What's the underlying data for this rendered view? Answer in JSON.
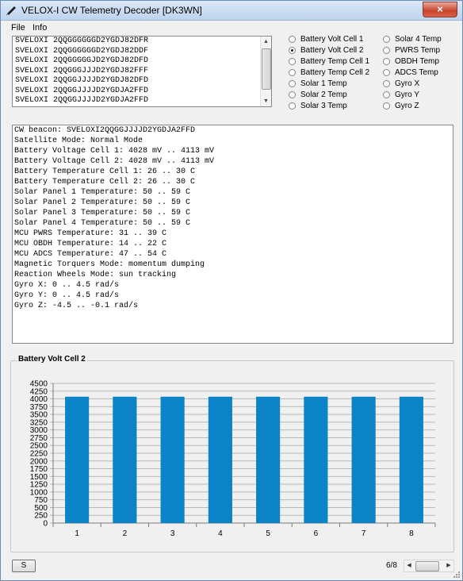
{
  "window": {
    "title": "VELOX-I CW Telemetry Decoder [DK3WN]",
    "close_symbol": "×"
  },
  "menu": {
    "items": [
      "File",
      "Info"
    ]
  },
  "beacon_list": [
    "SVELOXI 2QQGGGGGGD2YGDJ82DFR",
    "SVELOXI 2QQGGGGGGD2YGDJ82DDF",
    "SVELOXI 2QQGGGGGJD2YGDJ82DFD",
    "SVELOXI 2QQGGGJJJD2YGDJ82FFF",
    "SVELOXI 2QQGGJJJJD2YGDJ82DFD",
    "SVELOXI 2QQGGJJJJD2YGDJA2FFD",
    "SVELOXI 2QQGGJJJJD2YGDJA2FFD"
  ],
  "radio_col1": [
    {
      "label": "Battery Volt Cell 1",
      "checked": false
    },
    {
      "label": "Battery Volt Cell 2",
      "checked": true
    },
    {
      "label": "Battery Temp Cell 1",
      "checked": false
    },
    {
      "label": "Battery Temp Cell 2",
      "checked": false
    },
    {
      "label": "Solar 1 Temp",
      "checked": false
    },
    {
      "label": "Solar 2 Temp",
      "checked": false
    },
    {
      "label": "Solar 3 Temp",
      "checked": false
    }
  ],
  "radio_col2": [
    {
      "label": "Solar 4 Temp",
      "checked": false
    },
    {
      "label": "PWRS Temp",
      "checked": false
    },
    {
      "label": "OBDH Temp",
      "checked": false
    },
    {
      "label": "ADCS Temp",
      "checked": false
    },
    {
      "label": "Gyro X",
      "checked": false
    },
    {
      "label": "Gyro Y",
      "checked": false
    },
    {
      "label": "Gyro Z",
      "checked": false
    }
  ],
  "decoded": [
    "CW beacon: SVELOXI2QQGGJJJJD2YGDJA2FFD",
    "Satellite Mode: Normal Mode",
    "Battery Voltage Cell 1: 4028 mV .. 4113 mV",
    "Battery Voltage Cell 2: 4028 mV .. 4113 mV",
    "Battery Temperature Cell 1: 26 .. 30 C",
    "Battery Temperature Cell 2: 26 .. 30 C",
    "Solar Panel 1 Temperature: 50 .. 59 C",
    "Solar Panel 2 Temperature: 50 .. 59 C",
    "Solar Panel 3 Temperature: 50 .. 59 C",
    "Solar Panel 4 Temperature: 50 .. 59 C",
    "MCU PWRS Temperature: 31 .. 39 C",
    "MCU OBDH Temperature: 14 .. 22 C",
    "MCU ADCS Temperature: 47 .. 54 C",
    "Magnetic Torquers Mode: momentum dumping",
    "Reaction Wheels Mode: sun tracking",
    "Gyro X: 0 .. 4.5 rad/s",
    "Gyro Y: 0 .. 4.5 rad/s",
    "Gyro Z: -4.5 .. -0.1 rad/s"
  ],
  "chart_group_title": "Battery Volt Cell 2",
  "chart_data": {
    "type": "bar",
    "title": "",
    "xlabel": "",
    "ylabel": "",
    "categories": [
      "1",
      "2",
      "3",
      "4",
      "5",
      "6",
      "7",
      "8"
    ],
    "values": [
      4070,
      4070,
      4070,
      4070,
      4070,
      4070,
      4070,
      4070
    ],
    "ylim": [
      0,
      4500
    ],
    "yticks": [
      0,
      250,
      500,
      750,
      1000,
      1250,
      1500,
      1750,
      2000,
      2250,
      2500,
      2750,
      3000,
      3250,
      3500,
      3750,
      4000,
      4250,
      4500
    ],
    "grid": true,
    "bar_color": "#0a84c6"
  },
  "footer": {
    "s_button": "S",
    "page_indicator": "6/8"
  }
}
